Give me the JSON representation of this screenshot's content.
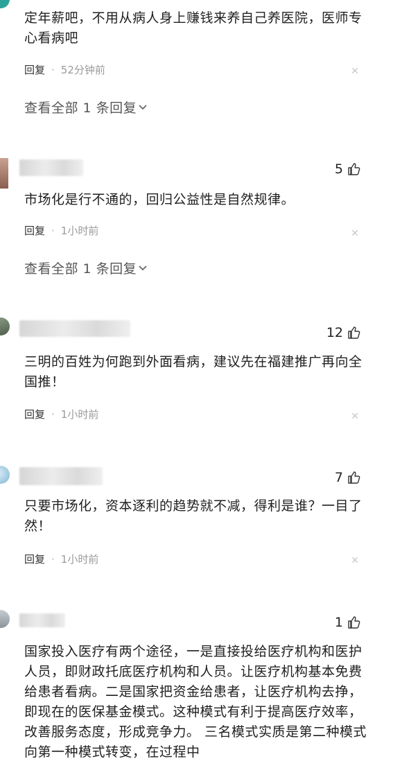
{
  "comments": [
    {
      "text": "定年薪吧，不用从病人身上赚钱来养自己养医院，医师专心看病吧",
      "reply_label": "回复",
      "time": "52分钟前",
      "view_all": "查看全部 1 条回复"
    },
    {
      "likes": "5",
      "text": "市场化是行不通的，回归公益性是自然规律。",
      "reply_label": "回复",
      "time": "1小时前",
      "view_all": "查看全部 1 条回复"
    },
    {
      "likes": "12",
      "text": "三明的百姓为何跑到外面看病，建议先在福建推广再向全国推！",
      "reply_label": "回复",
      "time": "1小时前"
    },
    {
      "likes": "7",
      "text": "只要市场化，资本逐利的趋势就不减，得利是谁？一目了然！",
      "reply_label": "回复",
      "time": "1小时前"
    },
    {
      "likes": "1",
      "text": "国家投入医疗有两个途径，一是直接投给医疗机构和医护人员，即财政托底医疗机构和人员。让医疗机构基本免费给患者看病。二是国家把资金给患者，让医疗机构去挣，即现在的医保基金模式。这种模式有利于提高医疗效率，改善服务态度，形成竞争力。 三名模式实质是第二种模式向第一种模式转变，在过程中"
    }
  ],
  "icons": {
    "like": "thumbs-up-icon",
    "close": "close-icon",
    "chevron": "chevron-down-icon"
  },
  "colors": {
    "meta": "#9a9a9a",
    "text": "#1f1f1f",
    "close": "#c8c8c8"
  }
}
